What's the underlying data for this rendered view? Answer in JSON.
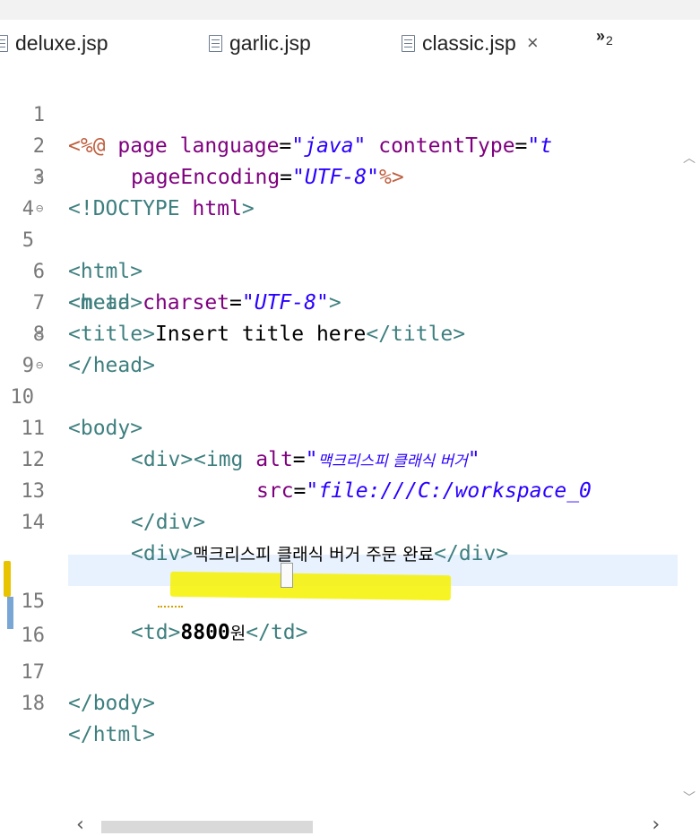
{
  "tabs": [
    {
      "label": "deluxe.jsp",
      "active": false
    },
    {
      "label": "garlic.jsp",
      "active": false
    },
    {
      "label": "classic.jsp",
      "active": true
    }
  ],
  "tab_close": "×",
  "overflow": {
    "symbol": "»",
    "count": "2"
  },
  "lines": [
    {
      "num": "1"
    },
    {
      "num": "2"
    },
    {
      "num": "3"
    },
    {
      "num": "4"
    },
    {
      "num": "5"
    },
    {
      "num": "6"
    },
    {
      "num": "7"
    },
    {
      "num": "8"
    },
    {
      "num": "9"
    },
    {
      "num": "10"
    },
    {
      "num": "11"
    },
    {
      "num": "12"
    },
    {
      "num": "13"
    },
    {
      "num": "14"
    },
    {
      "num": "15"
    },
    {
      "num": "16"
    },
    {
      "num": "17"
    },
    {
      "num": "18"
    }
  ],
  "code": {
    "l1": {
      "open": "<%@",
      "kw": " page ",
      "a1": "language",
      "eq1": "=",
      "v1": "\"java\"",
      "a2": " contentType",
      "eq2": "=",
      "v2": "\"t"
    },
    "l2": {
      "a1": "pageEncoding",
      "eq1": "=",
      "v1": "\"UTF-8\"",
      "close": "%>"
    },
    "l3": {
      "tag": "<!DOCTYPE ",
      "kw": "html",
      "close": ">"
    },
    "l4": {
      "tag": "<html>"
    },
    "l5": {
      "tag": "<head>"
    },
    "l6": {
      "tag": "<meta ",
      "a1": "charset",
      "eq": "=",
      "v1": "\"UTF-8\"",
      "close": ">"
    },
    "l7": {
      "open": "<title>",
      "text": "Insert title here",
      "close": "</title>"
    },
    "l8": {
      "tag": "</head>"
    },
    "l9": {
      "tag": "<body>"
    },
    "l10": {
      "tag": "<div>"
    },
    "l11": {
      "tag": "<img ",
      "a1": "alt",
      "eq": "=",
      "q1": "\"",
      "v1": "맥크리스피 클래식 버거",
      "q2": "\""
    },
    "l12": {
      "a1": "src",
      "eq": "=",
      "v1": "\"file:///C:/workspace_0"
    },
    "l13": {
      "tag": "</div>"
    },
    "l14": {
      "open": "<div>",
      "text": "맥크리스피 클래식 버거 주문 완료",
      "close": "</div>"
    },
    "l15": {
      "open": "<td>",
      "num": "8800",
      "kor": "원",
      "close": "</td>"
    },
    "l16": {},
    "l17": {
      "tag": "</body>"
    },
    "l18": {
      "tag": "</html>"
    }
  }
}
